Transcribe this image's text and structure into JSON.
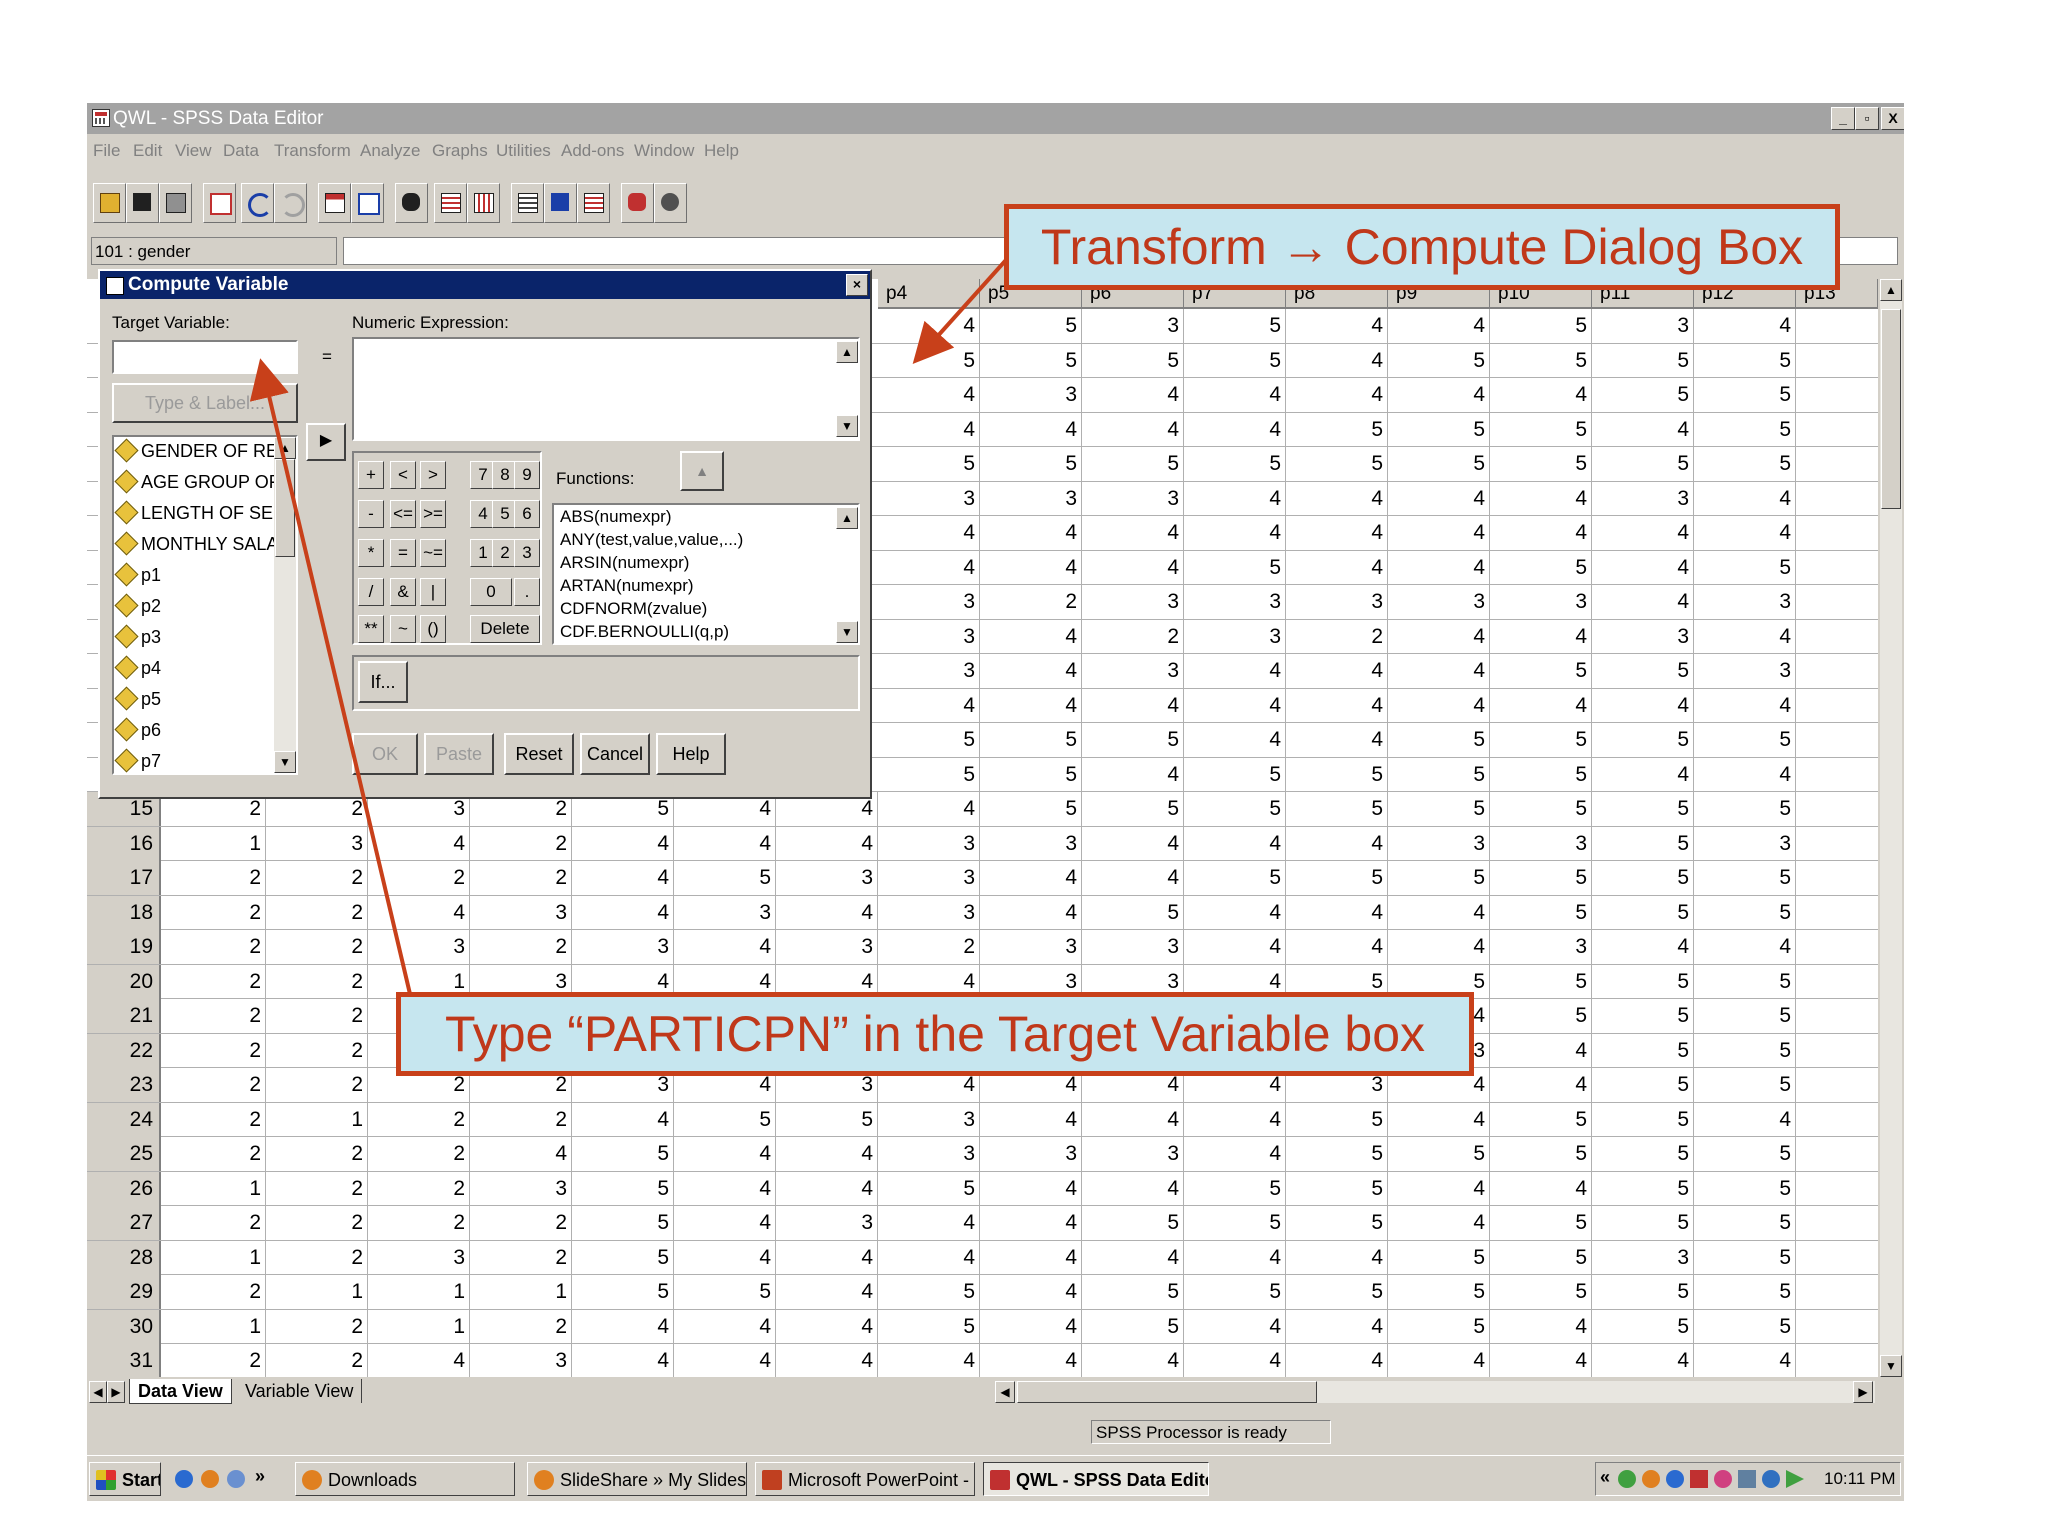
{
  "window": {
    "title": "QWL - SPSS Data Editor",
    "controls": [
      "_",
      "▫",
      "X"
    ]
  },
  "menu": [
    "File",
    "Edit",
    "View",
    "Data",
    "Transform",
    "Analyze",
    "Graphs",
    "Utilities",
    "Add-ons",
    "Window",
    "Help"
  ],
  "cell_ref": "101 : gender",
  "columns": [
    "p4",
    "p5",
    "p6",
    "p7",
    "p8",
    "p9",
    "p10",
    "p11",
    "p12",
    "p13"
  ],
  "rows": [
    {
      "n": "15",
      "v": [
        "2",
        "2",
        "3",
        "2",
        "5",
        "4",
        "4",
        "4",
        "5",
        "5",
        "5",
        "5",
        "5",
        "5",
        "5",
        "5"
      ]
    },
    {
      "n": "16",
      "v": [
        "1",
        "3",
        "4",
        "2",
        "4",
        "4",
        "4",
        "3",
        "3",
        "4",
        "4",
        "4",
        "3",
        "3",
        "5",
        "3"
      ]
    },
    {
      "n": "17",
      "v": [
        "2",
        "2",
        "2",
        "2",
        "4",
        "5",
        "3",
        "3",
        "4",
        "4",
        "5",
        "5",
        "5",
        "5",
        "5",
        "5"
      ]
    },
    {
      "n": "18",
      "v": [
        "2",
        "2",
        "4",
        "3",
        "4",
        "3",
        "4",
        "3",
        "4",
        "5",
        "4",
        "4",
        "4",
        "5",
        "5",
        "5"
      ]
    },
    {
      "n": "19",
      "v": [
        "2",
        "2",
        "3",
        "2",
        "3",
        "4",
        "3",
        "2",
        "3",
        "3",
        "4",
        "4",
        "4",
        "3",
        "4",
        "4"
      ]
    },
    {
      "n": "20",
      "v": [
        "2",
        "2",
        "1",
        "3",
        "4",
        "4",
        "4",
        "4",
        "3",
        "3",
        "4",
        "5",
        "5",
        "5",
        "5",
        "5"
      ]
    },
    {
      "n": "21",
      "v": [
        "2",
        "2",
        "",
        "",
        "",
        "",
        "",
        "",
        "",
        "",
        "",
        "",
        "4",
        "5",
        "5",
        "5"
      ]
    },
    {
      "n": "22",
      "v": [
        "2",
        "2",
        "",
        "",
        "",
        "",
        "",
        "",
        "",
        "",
        "",
        "",
        "3",
        "4",
        "5",
        "5"
      ]
    },
    {
      "n": "23",
      "v": [
        "2",
        "2",
        "2",
        "2",
        "3",
        "4",
        "3",
        "4",
        "4",
        "4",
        "4",
        "3",
        "4",
        "4",
        "5",
        "5"
      ]
    },
    {
      "n": "24",
      "v": [
        "2",
        "1",
        "2",
        "2",
        "4",
        "5",
        "5",
        "3",
        "4",
        "4",
        "4",
        "5",
        "4",
        "5",
        "5",
        "4"
      ]
    },
    {
      "n": "25",
      "v": [
        "2",
        "2",
        "2",
        "4",
        "5",
        "4",
        "4",
        "3",
        "3",
        "3",
        "4",
        "5",
        "5",
        "5",
        "5",
        "5"
      ]
    },
    {
      "n": "26",
      "v": [
        "1",
        "2",
        "2",
        "3",
        "5",
        "4",
        "4",
        "5",
        "4",
        "4",
        "5",
        "5",
        "4",
        "4",
        "5",
        "5"
      ]
    },
    {
      "n": "27",
      "v": [
        "2",
        "2",
        "2",
        "2",
        "5",
        "4",
        "3",
        "4",
        "4",
        "5",
        "5",
        "5",
        "4",
        "5",
        "5",
        "5"
      ]
    },
    {
      "n": "28",
      "v": [
        "1",
        "2",
        "3",
        "2",
        "5",
        "4",
        "4",
        "4",
        "4",
        "4",
        "4",
        "4",
        "5",
        "5",
        "3",
        "5"
      ]
    },
    {
      "n": "29",
      "v": [
        "2",
        "1",
        "1",
        "1",
        "5",
        "5",
        "4",
        "5",
        "4",
        "5",
        "5",
        "5",
        "5",
        "5",
        "5",
        "5"
      ]
    },
    {
      "n": "30",
      "v": [
        "1",
        "2",
        "1",
        "2",
        "4",
        "4",
        "4",
        "5",
        "4",
        "5",
        "4",
        "4",
        "5",
        "4",
        "5",
        "5"
      ]
    },
    {
      "n": "31",
      "v": [
        "2",
        "2",
        "4",
        "3",
        "4",
        "4",
        "4",
        "4",
        "4",
        "4",
        "4",
        "4",
        "4",
        "4",
        "4",
        "4"
      ]
    }
  ],
  "upper_rows": [
    [
      "4",
      "5",
      "3",
      "5",
      "4",
      "4",
      "5",
      "3",
      "4"
    ],
    [
      "5",
      "5",
      "5",
      "5",
      "4",
      "5",
      "5",
      "5",
      "5"
    ],
    [
      "4",
      "3",
      "4",
      "4",
      "4",
      "4",
      "4",
      "5",
      "5"
    ],
    [
      "4",
      "4",
      "4",
      "4",
      "5",
      "5",
      "5",
      "4",
      "5"
    ],
    [
      "5",
      "5",
      "5",
      "5",
      "5",
      "5",
      "5",
      "5",
      "5"
    ],
    [
      "3",
      "3",
      "3",
      "4",
      "4",
      "4",
      "4",
      "3",
      "4"
    ],
    [
      "4",
      "4",
      "4",
      "4",
      "4",
      "4",
      "4",
      "4",
      "4"
    ],
    [
      "4",
      "4",
      "4",
      "5",
      "4",
      "4",
      "5",
      "4",
      "5"
    ],
    [
      "3",
      "2",
      "3",
      "3",
      "3",
      "3",
      "3",
      "4",
      "3"
    ],
    [
      "3",
      "4",
      "2",
      "3",
      "2",
      "4",
      "4",
      "3",
      "4"
    ],
    [
      "3",
      "4",
      "3",
      "4",
      "4",
      "4",
      "5",
      "5",
      "3"
    ],
    [
      "4",
      "4",
      "4",
      "4",
      "4",
      "4",
      "4",
      "4",
      "4"
    ],
    [
      "5",
      "5",
      "5",
      "4",
      "4",
      "5",
      "5",
      "5",
      "5"
    ],
    [
      "5",
      "5",
      "4",
      "5",
      "5",
      "5",
      "5",
      "4",
      "4"
    ]
  ],
  "tabs": {
    "data_view": "Data View",
    "variable_view": "Variable View"
  },
  "status": "SPSS Processor  is ready",
  "taskbar": {
    "start": "Start",
    "items": [
      "Downloads",
      "SlideShare » My Slidespa...",
      "Microsoft PowerPoint - [...",
      "QWL - SPSS Data Editor"
    ],
    "clock": "10:11 PM",
    "overflow": "»",
    "tray_chevron": "«"
  },
  "dialog": {
    "title": "Compute Variable",
    "target_label": "Target Variable:",
    "target_value": "",
    "equals": "=",
    "numeric_label": "Numeric Expression:",
    "type_label_btn": "Type & Label...",
    "variables": [
      "GENDER OF RESI",
      "AGE GROUP OF R",
      "LENGTH OF SERV",
      "MONTHLY SALAR",
      "p1",
      "p2",
      "p3",
      "p4",
      "p5",
      "p6",
      "p7"
    ],
    "keypad": [
      "+",
      "<",
      ">",
      "7",
      "8",
      "9",
      "-",
      "<=",
      ">=",
      "4",
      "5",
      "6",
      "*",
      "=",
      "~=",
      "1",
      "2",
      "3",
      "/",
      "&",
      "|",
      "0",
      ".",
      "**",
      "~",
      "()",
      "Delete"
    ],
    "functions_label": "Functions:",
    "functions": [
      "ABS(numexpr)",
      "ANY(test,value,value,...)",
      "ARSIN(numexpr)",
      "ARTAN(numexpr)",
      "CDFNORM(zvalue)",
      "CDF.BERNOULLI(q,p)"
    ],
    "if_btn": "If...",
    "buttons": [
      "OK",
      "Paste",
      "Reset",
      "Cancel",
      "Help"
    ]
  },
  "callouts": {
    "top": "Transform → Compute Dialog Box",
    "bottom": "Type “PARTICPN” in the Target Variable box"
  },
  "colors": {
    "accent": "#c8401a",
    "callout_bg": "#c6e6ef",
    "dialog_title": "#0a246a"
  }
}
